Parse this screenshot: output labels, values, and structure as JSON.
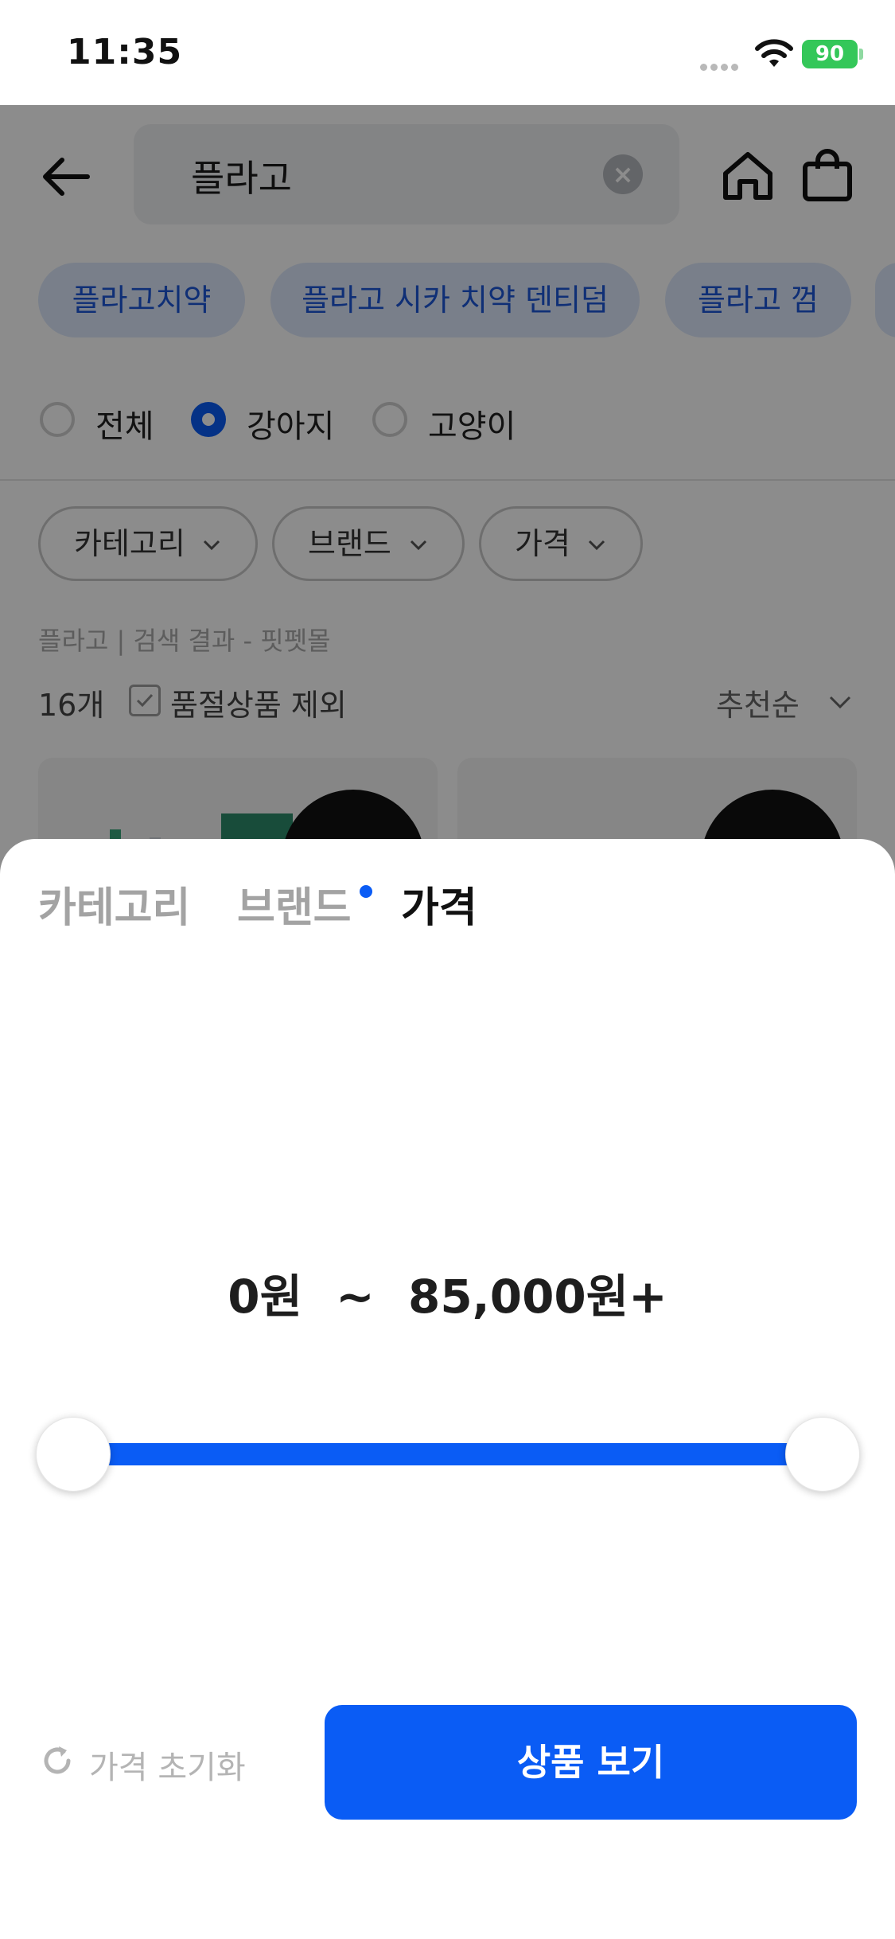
{
  "status_bar": {
    "time": "11:35",
    "battery": "90"
  },
  "header": {
    "search_value": "플라고"
  },
  "chips": [
    "플라고치약",
    "플라고 시카 치약 덴티덤",
    "플라고 껌"
  ],
  "pet_filter": {
    "options": [
      "전체",
      "강아지",
      "고양이"
    ],
    "selected": "강아지"
  },
  "filters": [
    "카테고리",
    "브랜드",
    "가격"
  ],
  "breadcrumb": "플라고 | 검색 결과 - 핏펫몰",
  "results": {
    "count": "16개",
    "exclude_sold_out": "품절상품 제외",
    "exclude_checked": true,
    "sort": "추천순"
  },
  "sheet": {
    "tabs": [
      "카테고리",
      "브랜드",
      "가격"
    ],
    "active_tab": "가격",
    "range_min": "0원",
    "range_sep": "~",
    "range_max": "85,000원+",
    "slider": {
      "min_fraction": 0.0,
      "max_fraction": 1.0
    },
    "reset_label": "가격 초기화",
    "cta_label": "상품 보기"
  },
  "colors": {
    "accent": "#0a5cf5",
    "chip_bg": "#dde8fb",
    "battery": "#34c759"
  }
}
